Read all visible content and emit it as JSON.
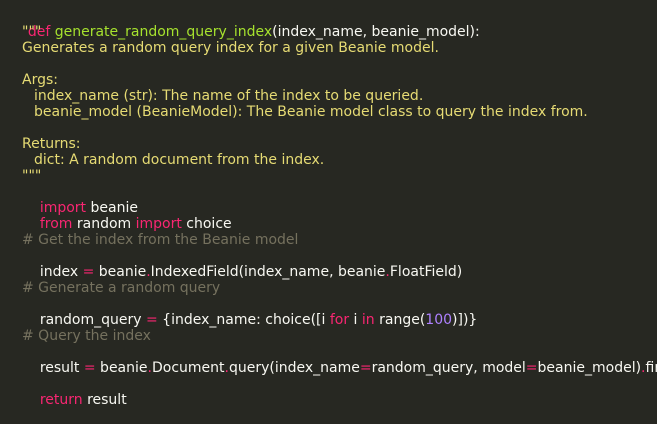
{
  "code": {
    "l1": {
      "kw": "def",
      "fn": "generate_random_query_index",
      "params": "(index_name, beanie_model):"
    },
    "l2": "\"\"\"",
    "l3": "Generates a random query index for a given Beanie model.",
    "l4": "Args:",
    "l5": "index_name (str): The name of the index to be queried.",
    "l6": "beanie_model (BeanieModel): The Beanie model class to query the index from.",
    "l7": "Returns:",
    "l8": "dict: A random document from the index.",
    "l9": "\"\"\"",
    "l10": {
      "kw": "import",
      "rest": " beanie"
    },
    "l11": {
      "kw1": "from",
      "mid": " random ",
      "kw2": "import",
      "rest": " choice"
    },
    "l12": "# Get the index from the Beanie model",
    "l13": {
      "a": "index ",
      "op": "=",
      "b": " beanie",
      "dot": ".",
      "c": "IndexedField(index_name, beanie",
      "dot2": ".",
      "d": "FloatField)"
    },
    "l14": "# Generate a random query",
    "l15": {
      "a": "random_query ",
      "op": "=",
      "b": " {index_name: choice([i ",
      "kw1": "for",
      "c": " i ",
      "kw2": "in",
      "d": " range(",
      "num": "100",
      "e": ")])}"
    },
    "l16": "# Query the index",
    "l17": {
      "a": "result ",
      "op": "=",
      "b": " beanie",
      "dot": ".",
      "c": "Document",
      "dot2": ".",
      "d": "query(index_name",
      "op2": "=",
      "e": "random_query, model",
      "op3": "=",
      "f": "beanie_model)",
      "dot3": ".",
      "g": "first()"
    },
    "l18": {
      "kw": "return",
      "rest": " result"
    }
  }
}
